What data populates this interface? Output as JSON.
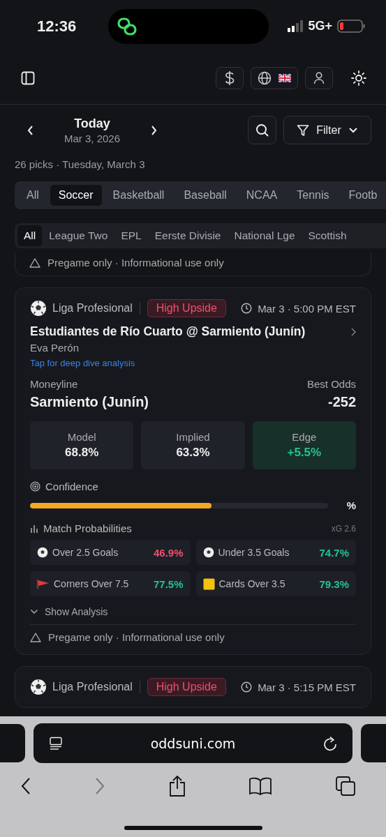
{
  "status_bar": {
    "time": "12:36",
    "network": "5G+"
  },
  "date_nav": {
    "title": "Today",
    "date": "Mar 3, 2026",
    "filter_label": "Filter",
    "summary": "26 picks · Tuesday, March 3"
  },
  "sport_tabs": [
    {
      "label": "All",
      "selected": false
    },
    {
      "label": "Soccer",
      "selected": true
    },
    {
      "label": "Basketball",
      "selected": false
    },
    {
      "label": "Baseball",
      "selected": false
    },
    {
      "label": "NCAA",
      "selected": false
    },
    {
      "label": "Tennis",
      "selected": false
    },
    {
      "label": "Footb",
      "selected": false
    }
  ],
  "league_tabs": [
    {
      "label": "All",
      "selected": true
    },
    {
      "label": "League Two",
      "selected": false
    },
    {
      "label": "EPL",
      "selected": false
    },
    {
      "label": "Eerste Divisie",
      "selected": false
    },
    {
      "label": "National Lge",
      "selected": false
    },
    {
      "label": "Scottish",
      "selected": false
    }
  ],
  "previous_card": {
    "footer": "Pregame only · Informational use only"
  },
  "cards": [
    {
      "league": "Liga Profesional",
      "badge": "High Upside",
      "time": "Mar 3 · 5:00 PM EST",
      "matchup": "Estudiantes de Río Cuarto @ Sarmiento (Junín)",
      "venue": "Eva Perón",
      "deep_dive_link": "Tap for deep dive analysis",
      "market_label": "Moneyline",
      "odds_label": "Best Odds",
      "pick": "Sarmiento (Junín)",
      "odds": "-252",
      "stats": [
        {
          "label": "Model",
          "value": "68.8%",
          "kind": "plain"
        },
        {
          "label": "Implied",
          "value": "63.3%",
          "kind": "plain"
        },
        {
          "label": "Edge",
          "value": "+5.5%",
          "kind": "edge"
        }
      ],
      "confidence": {
        "label": "Confidence",
        "level": 0.61,
        "value": "%"
      },
      "probabilities": {
        "title": "Match Probabilities",
        "xg": "xG 2.6",
        "items": [
          {
            "kind": "ball",
            "label": "Over 2.5 Goals",
            "value": "46.9%",
            "color": "#f0506e"
          },
          {
            "kind": "ball",
            "label": "Under 3.5 Goals",
            "value": "74.7%",
            "color": "#24c48e"
          },
          {
            "kind": "flag",
            "label": "Corners Over 7.5",
            "value": "77.5%",
            "color": "#24c48e"
          },
          {
            "kind": "card",
            "label": "Cards Over 3.5",
            "value": "79.3%",
            "color": "#24c48e"
          }
        ]
      },
      "analysis_toggle": {
        "label": "Show Analysis",
        "expanded": false
      },
      "footer": "Pregame only · Informational use only"
    },
    {
      "league": "Liga Profesional",
      "badge": "High Upside",
      "time": "Mar 3 · 5:15 PM EST"
    }
  ],
  "browser": {
    "url": "oddsuni.com"
  }
}
